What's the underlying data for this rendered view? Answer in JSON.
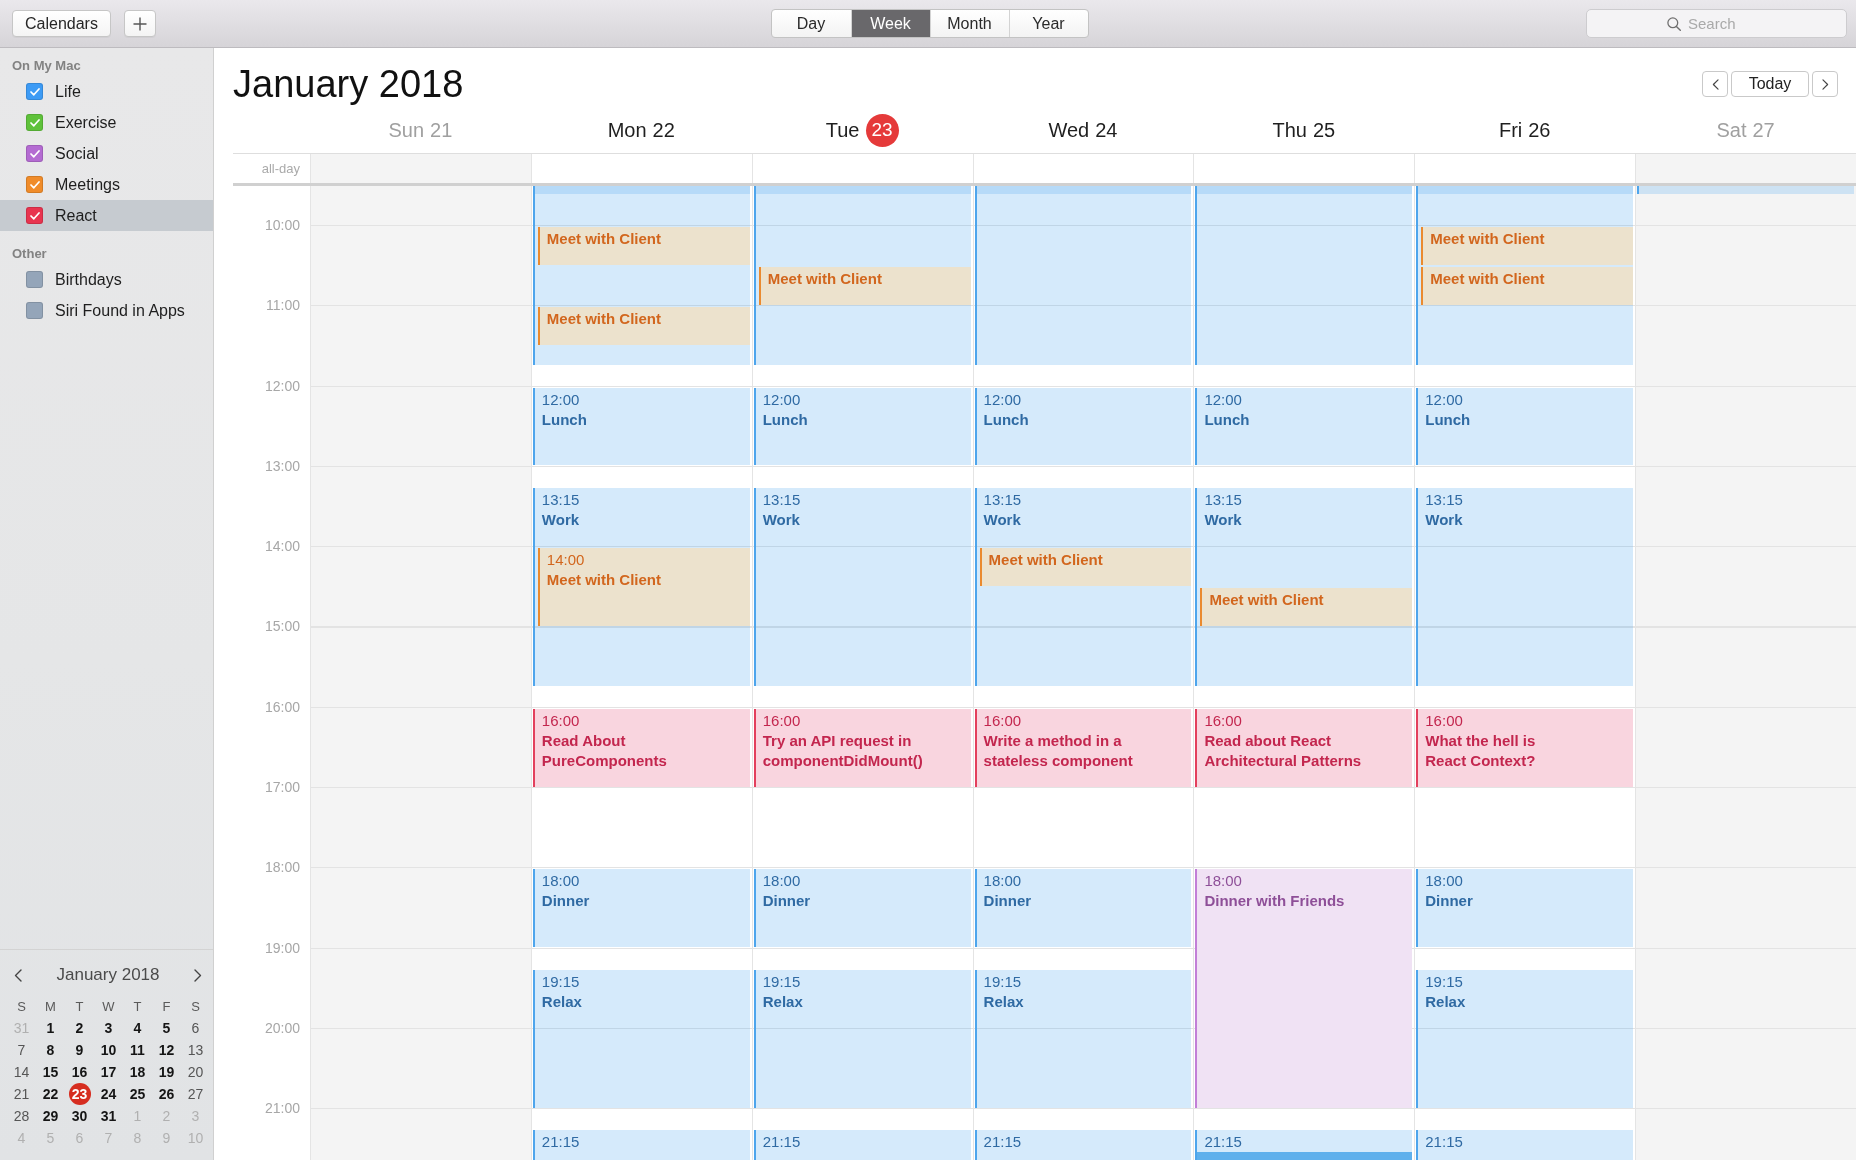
{
  "toolbar": {
    "calendars_button": "Calendars",
    "views": [
      {
        "label": "Day",
        "selected": false
      },
      {
        "label": "Week",
        "selected": true
      },
      {
        "label": "Month",
        "selected": false
      },
      {
        "label": "Year",
        "selected": false
      }
    ],
    "search": {
      "placeholder": "Search"
    }
  },
  "sidebar": {
    "sections": [
      {
        "title": "On My Mac",
        "calendars": [
          {
            "name": "Life",
            "color": "#3d9bf5",
            "checked": true,
            "selected": false
          },
          {
            "name": "Exercise",
            "color": "#5fc23b",
            "checked": true,
            "selected": false
          },
          {
            "name": "Social",
            "color": "#b46bd2",
            "checked": true,
            "selected": false
          },
          {
            "name": "Meetings",
            "color": "#f08c2a",
            "checked": true,
            "selected": false
          },
          {
            "name": "React",
            "color": "#e8344f",
            "checked": true,
            "selected": true
          }
        ]
      },
      {
        "title": "Other",
        "calendars": [
          {
            "name": "Birthdays",
            "color": "#94a5b9",
            "checked": false,
            "selected": false
          },
          {
            "name": "Siri Found in Apps",
            "color": "#94a5b9",
            "checked": false,
            "selected": false
          }
        ]
      }
    ],
    "mini_calendar": {
      "title": "January 2018",
      "weekdays": [
        "S",
        "M",
        "T",
        "W",
        "T",
        "F",
        "S"
      ],
      "weeks": [
        [
          {
            "label": "31",
            "kind": "outside",
            "today": false
          },
          {
            "label": "1",
            "kind": "weekday",
            "today": false
          },
          {
            "label": "2",
            "kind": "weekday",
            "today": false
          },
          {
            "label": "3",
            "kind": "weekday",
            "today": false
          },
          {
            "label": "4",
            "kind": "weekday",
            "today": false
          },
          {
            "label": "5",
            "kind": "weekday",
            "today": false
          },
          {
            "label": "6",
            "kind": "weekend",
            "today": false
          }
        ],
        [
          {
            "label": "7",
            "kind": "weekend",
            "today": false
          },
          {
            "label": "8",
            "kind": "weekday",
            "today": false
          },
          {
            "label": "9",
            "kind": "weekday",
            "today": false
          },
          {
            "label": "10",
            "kind": "weekday",
            "today": false
          },
          {
            "label": "11",
            "kind": "weekday",
            "today": false
          },
          {
            "label": "12",
            "kind": "weekday",
            "today": false
          },
          {
            "label": "13",
            "kind": "weekend",
            "today": false
          }
        ],
        [
          {
            "label": "14",
            "kind": "weekend",
            "today": false
          },
          {
            "label": "15",
            "kind": "weekday",
            "today": false
          },
          {
            "label": "16",
            "kind": "weekday",
            "today": false
          },
          {
            "label": "17",
            "kind": "weekday",
            "today": false
          },
          {
            "label": "18",
            "kind": "weekday",
            "today": false
          },
          {
            "label": "19",
            "kind": "weekday",
            "today": false
          },
          {
            "label": "20",
            "kind": "weekend",
            "today": false
          }
        ],
        [
          {
            "label": "21",
            "kind": "weekend",
            "today": false
          },
          {
            "label": "22",
            "kind": "weekday",
            "today": false
          },
          {
            "label": "23",
            "kind": "weekday",
            "today": true
          },
          {
            "label": "24",
            "kind": "weekday",
            "today": false
          },
          {
            "label": "25",
            "kind": "weekday",
            "today": false
          },
          {
            "label": "26",
            "kind": "weekday",
            "today": false
          },
          {
            "label": "27",
            "kind": "weekend",
            "today": false
          }
        ],
        [
          {
            "label": "28",
            "kind": "weekend",
            "today": false
          },
          {
            "label": "29",
            "kind": "weekday",
            "today": false
          },
          {
            "label": "30",
            "kind": "weekday",
            "today": false
          },
          {
            "label": "31",
            "kind": "weekday",
            "today": false
          },
          {
            "label": "1",
            "kind": "outside",
            "today": false
          },
          {
            "label": "2",
            "kind": "outside",
            "today": false
          },
          {
            "label": "3",
            "kind": "outside",
            "today": false
          }
        ],
        [
          {
            "label": "4",
            "kind": "outside",
            "today": false
          },
          {
            "label": "5",
            "kind": "outside",
            "today": false
          },
          {
            "label": "6",
            "kind": "outside",
            "today": false
          },
          {
            "label": "7",
            "kind": "outside",
            "today": false
          },
          {
            "label": "8",
            "kind": "outside",
            "today": false
          },
          {
            "label": "9",
            "kind": "outside",
            "today": false
          },
          {
            "label": "10",
            "kind": "outside",
            "today": false
          }
        ]
      ]
    }
  },
  "header": {
    "title": "January 2018",
    "today_button": "Today"
  },
  "week": {
    "all_day_label": "all-day",
    "hour_labels": [
      "10:00",
      "11:00",
      "12:00",
      "13:00",
      "14:00",
      "15:00",
      "16:00",
      "17:00",
      "18:00",
      "19:00",
      "20:00",
      "21:00"
    ],
    "days": [
      {
        "name": "Sun",
        "date": "21",
        "weekend": true,
        "today": false
      },
      {
        "name": "Mon",
        "date": "22",
        "weekend": false,
        "today": false,
        "events": [
          {
            "kind": "life",
            "selected": false
          },
          {
            "kind": "life",
            "selected": false
          },
          {
            "kind": "meetings",
            "title": "Meet with Client",
            "selected": false
          },
          {
            "kind": "meetings",
            "title": "Meet with Client",
            "selected": false
          },
          {
            "kind": "life",
            "time": "12:00",
            "title": "Lunch",
            "selected": false
          },
          {
            "kind": "life",
            "time": "13:15",
            "title": "Work",
            "selected": false
          },
          {
            "kind": "meetings",
            "time": "14:00",
            "title": "Meet with Client",
            "selected": false
          },
          {
            "kind": "react",
            "time": "16:00",
            "title": "Read About\nPureComponents",
            "selected": false
          },
          {
            "kind": "life",
            "time": "18:00",
            "title": "Dinner",
            "selected": false
          },
          {
            "kind": "life",
            "time": "19:15",
            "title": "Relax",
            "selected": false
          },
          {
            "kind": "life",
            "time": "21:15",
            "selected": false
          }
        ]
      },
      {
        "name": "Tue",
        "date": "23",
        "weekend": false,
        "today": true,
        "events": [
          {
            "kind": "life",
            "selected": false
          },
          {
            "kind": "life",
            "selected": false
          },
          {
            "kind": "meetings",
            "title": "Meet with Client",
            "selected": false
          },
          {
            "kind": "life",
            "time": "12:00",
            "title": "Lunch",
            "selected": false
          },
          {
            "kind": "life",
            "time": "13:15",
            "title": "Work",
            "selected": false
          },
          {
            "kind": "react",
            "time": "16:00",
            "title": "Try an API request in\ncomponentDidMount()",
            "selected": false
          },
          {
            "kind": "life",
            "time": "18:00",
            "title": "Dinner",
            "selected": false
          },
          {
            "kind": "life",
            "time": "19:15",
            "title": "Relax",
            "selected": false
          },
          {
            "kind": "life",
            "time": "21:15",
            "selected": false
          }
        ]
      },
      {
        "name": "Wed",
        "date": "24",
        "weekend": false,
        "today": false,
        "events": [
          {
            "kind": "life",
            "selected": false
          },
          {
            "kind": "life",
            "selected": false
          },
          {
            "kind": "life",
            "time": "12:00",
            "title": "Lunch",
            "selected": false
          },
          {
            "kind": "life",
            "time": "13:15",
            "title": "Work",
            "selected": false
          },
          {
            "kind": "meetings",
            "title": "Meet with Client",
            "selected": false
          },
          {
            "kind": "react",
            "time": "16:00",
            "title": "Write a method in a\nstateless component",
            "selected": false
          },
          {
            "kind": "life",
            "time": "18:00",
            "title": "Dinner",
            "selected": false
          },
          {
            "kind": "life",
            "time": "19:15",
            "title": "Relax",
            "selected": false
          },
          {
            "kind": "life",
            "time": "21:15",
            "selected": false
          }
        ]
      },
      {
        "name": "Thu",
        "date": "25",
        "weekend": false,
        "today": false,
        "events": [
          {
            "kind": "life",
            "selected": false
          },
          {
            "kind": "life",
            "selected": false
          },
          {
            "kind": "life",
            "time": "12:00",
            "title": "Lunch",
            "selected": false
          },
          {
            "kind": "life",
            "time": "13:15",
            "title": "Work",
            "selected": false
          },
          {
            "kind": "meetings",
            "title": "Meet with Client",
            "selected": false
          },
          {
            "kind": "react",
            "time": "16:00",
            "title": "Read about React\nArchitectural Patterns",
            "selected": false
          },
          {
            "kind": "social",
            "time": "18:00",
            "title": "Dinner with Friends",
            "selected": false
          },
          {
            "kind": "life",
            "time": "21:15",
            "selected": false
          },
          {
            "kind": "life",
            "selected": true
          }
        ]
      },
      {
        "name": "Fri",
        "date": "26",
        "weekend": false,
        "today": false,
        "events": [
          {
            "kind": "life",
            "selected": false
          },
          {
            "kind": "life",
            "selected": false
          },
          {
            "kind": "meetings",
            "title": "Meet with Client",
            "selected": false
          },
          {
            "kind": "meetings",
            "title": "Meet with Client",
            "selected": false
          },
          {
            "kind": "life",
            "time": "12:00",
            "title": "Lunch",
            "selected": false
          },
          {
            "kind": "life",
            "time": "13:15",
            "title": "Work",
            "selected": false
          },
          {
            "kind": "react",
            "time": "16:00",
            "title": "What the hell is\nReact Context?",
            "selected": false
          },
          {
            "kind": "life",
            "time": "18:00",
            "title": "Dinner",
            "selected": false
          },
          {
            "kind": "life",
            "time": "19:15",
            "title": "Relax",
            "selected": false
          },
          {
            "kind": "life",
            "time": "21:15",
            "selected": false
          }
        ]
      },
      {
        "name": "Sat",
        "date": "27",
        "weekend": true,
        "today": false,
        "events": [
          {
            "kind": "life",
            "selected": false
          }
        ]
      }
    ]
  }
}
